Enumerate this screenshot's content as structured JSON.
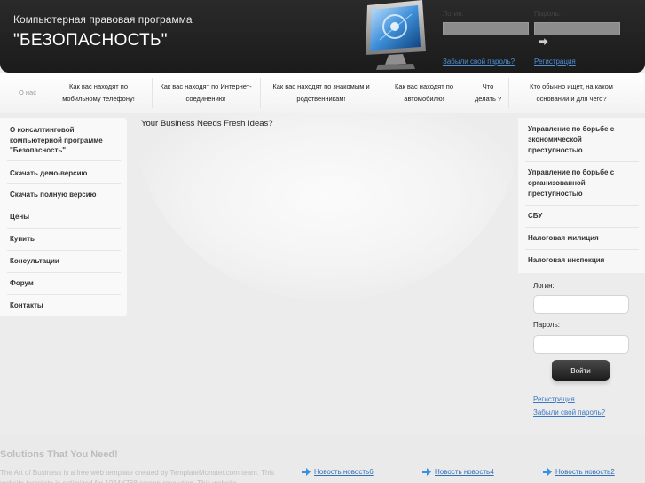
{
  "header": {
    "tagline": "Компьютерная правовая программа",
    "title": "\"БЕЗОПАСНОСТЬ\"",
    "login_label": "Логин:",
    "password_label": "Пароль:",
    "forgot_link": "Забыли свой пароль?",
    "register_link": "Регистрация"
  },
  "nav": {
    "items": [
      {
        "label": "О нас"
      },
      {
        "label": "Как вас находят по мобильному телефону!"
      },
      {
        "label": "Как вас находят по Интернет-соединению!"
      },
      {
        "label": "Как вас находят по знакомым и родственникам!"
      },
      {
        "label": "Как вас находят по автомобилю!"
      },
      {
        "label": "Что делать ?"
      },
      {
        "label": "Кто обычно ищет, на каком основании и для чего?"
      }
    ]
  },
  "left_menu": {
    "items": [
      {
        "label": "О консалтинговой компьютерной программе \"Безопасность\""
      },
      {
        "label": "Скачать демо-версию"
      },
      {
        "label": "Скачать полную версию"
      },
      {
        "label": "Цены"
      },
      {
        "label": "Купить"
      },
      {
        "label": "Консультации"
      },
      {
        "label": "Форум"
      },
      {
        "label": "Контакты"
      }
    ]
  },
  "main": {
    "title": "Your Business Needs Fresh Ideas?"
  },
  "right_menu": {
    "items": [
      {
        "label": "Управление по борьбе с экономической преступностью"
      },
      {
        "label": "Управление по борьбе с организованной преступностью"
      },
      {
        "label": "СБУ"
      },
      {
        "label": "Налоговая милиция"
      },
      {
        "label": "Налоговая инспекция"
      }
    ]
  },
  "login_form": {
    "login_label": "Логин:",
    "password_label": "Пароль:",
    "submit_label": "Войти",
    "register_link": "Регистрация",
    "forgot_link": "Забыли свой пароль?"
  },
  "footer": {
    "title": "Solutions That You Need!",
    "text": "The Art of Business is a free web template created by TemplateMonster.com team. This website template is optimized for 1024X768 screen resolution. This website",
    "news": [
      {
        "label": "Новость новость6"
      },
      {
        "label": "Новость новость4"
      },
      {
        "label": "Новость новость2"
      }
    ]
  },
  "colors": {
    "header_bg": "#1f1f1f",
    "link": "#3a78c4",
    "footer_text": "#bdbdbd"
  }
}
